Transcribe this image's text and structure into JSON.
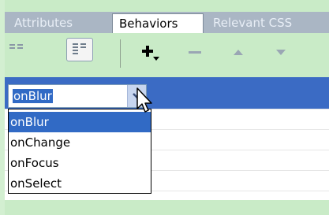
{
  "tabs": [
    {
      "label": "Attributes",
      "active": false
    },
    {
      "label": "Behaviors",
      "active": true
    },
    {
      "label": "Relevant CSS",
      "active": false
    }
  ],
  "toolbar": {
    "show_set_events_icon": "show-set-events-icon",
    "show_all_events_icon": "show-all-events-icon",
    "add_behavior_icon": "plus-dropdown-icon",
    "remove_behavior_icon": "minus-icon",
    "move_up_icon": "triangle-up-icon",
    "move_down_icon": "triangle-down-icon"
  },
  "event_combo": {
    "value": "onBlur"
  },
  "event_options": [
    {
      "label": "onBlur",
      "selected": true
    },
    {
      "label": "onChange",
      "selected": false
    },
    {
      "label": "onFocus",
      "selected": false
    },
    {
      "label": "onSelect",
      "selected": false
    }
  ],
  "colors": {
    "panel_bg": "#c9ebc7",
    "tabbar_bg": "#aab6c4",
    "selection_blue": "#316ac5",
    "row_selected": "#3b6bc4"
  }
}
